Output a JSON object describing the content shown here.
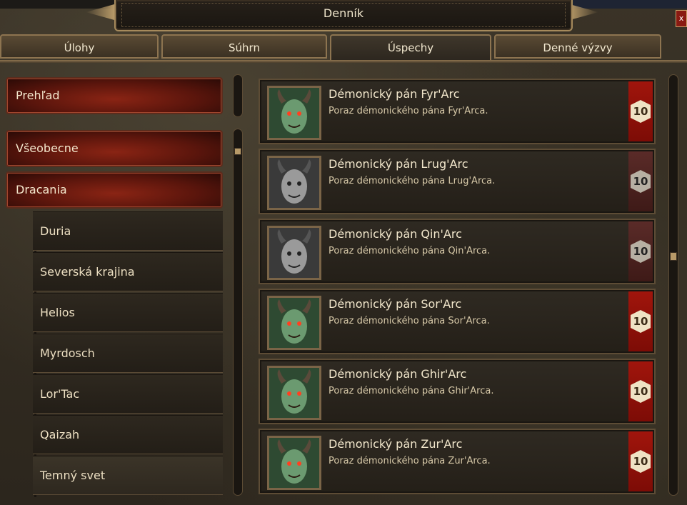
{
  "window": {
    "title": "Denník",
    "close_label": "x"
  },
  "tabs": [
    {
      "label": "Úlohy"
    },
    {
      "label": "Súhrn"
    },
    {
      "label": "Úspechy"
    },
    {
      "label": "Denné výzvy"
    }
  ],
  "active_tab": "Úspechy",
  "sidebar": {
    "overview": "Prehľad",
    "general": "Všeobecne",
    "category": "Dracania",
    "subitems": [
      {
        "label": "Duria"
      },
      {
        "label": "Severská krajina"
      },
      {
        "label": "Helios"
      },
      {
        "label": "Myrdosch"
      },
      {
        "label": "Lor'Tac"
      },
      {
        "label": "Qaizah"
      },
      {
        "label": "Temný svet"
      }
    ]
  },
  "achievements": [
    {
      "title": "Démonický pán Fyr'Arc",
      "desc": "Poraz démonického pána Fyr'Arca.",
      "points": "10",
      "completed": true
    },
    {
      "title": "Démonický pán Lrug'Arc",
      "desc": "Poraz démonického pána Lrug'Arca.",
      "points": "10",
      "completed": false
    },
    {
      "title": "Démonický pán Qin'Arc",
      "desc": "Poraz démonického pána Qin'Arca.",
      "points": "10",
      "completed": false
    },
    {
      "title": "Démonický pán Sor'Arc",
      "desc": "Poraz démonického pána Sor'Arca.",
      "points": "10",
      "completed": true
    },
    {
      "title": "Démonický pán Ghir'Arc",
      "desc": "Poraz démonického pána Ghir'Arca.",
      "points": "10",
      "completed": true
    },
    {
      "title": "Démonický pán Zur'Arc",
      "desc": "Poraz démonického pána Zur'Arca.",
      "points": "10",
      "completed": true
    }
  ],
  "colors": {
    "banner_red": "#a0150c",
    "banner_grey": "#5a2b28",
    "gold": "#b89a68"
  }
}
